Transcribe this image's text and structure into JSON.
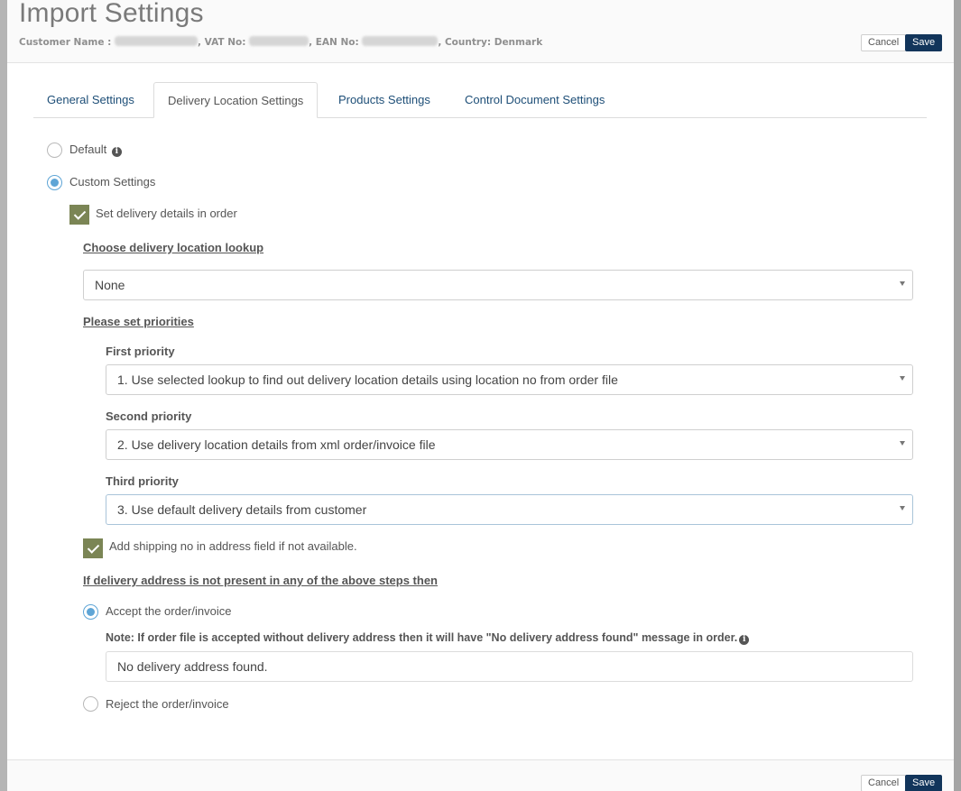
{
  "dialog": {
    "title": "Import Settings",
    "customer_line": {
      "customer_label": "Customer Name :",
      "vat_label": ", VAT No:",
      "ean_label": ", EAN No:",
      "country_text": ", Country: Denmark"
    },
    "cancel_label": "Cancel",
    "save_label": "Save"
  },
  "tabs": [
    {
      "label": "General Settings",
      "active": false
    },
    {
      "label": "Delivery Location Settings",
      "active": true
    },
    {
      "label": "Products Settings",
      "active": false
    },
    {
      "label": "Control Document Settings",
      "active": false
    }
  ],
  "mode": {
    "default_label": "Default",
    "custom_label": "Custom Settings",
    "selected": "custom"
  },
  "delivery": {
    "set_details_label": "Set delivery details in order",
    "set_details_checked": true,
    "lookup_heading": "Choose delivery location lookup",
    "lookup_value": "None",
    "priorities_heading": "Please set priorities",
    "priorities": [
      {
        "label": "First priority",
        "value": "1. Use selected lookup to find out delivery location details using location no from order file"
      },
      {
        "label": "Second priority",
        "value": "2. Use delivery location details from xml order/invoice file"
      },
      {
        "label": "Third priority",
        "value": "3. Use default delivery details from customer"
      }
    ],
    "shipping_no_label": "Add shipping no in address field if not available.",
    "shipping_no_checked": true,
    "fallback_heading": "If delivery address is not present in any of the above steps then",
    "accept_label": "Accept the order/invoice",
    "note_text": "Note: If order file is accepted without delivery address then it will have \"No delivery address found\" message in order.",
    "message_value": "No delivery address found.",
    "reject_label": "Reject the order/invoice",
    "fallback_selected": "accept"
  },
  "colors": {
    "save_button": "#12355b",
    "tab_link": "#1d4e77",
    "radio_checked": "#5ea5d6",
    "checkbox": "#7b8555"
  }
}
